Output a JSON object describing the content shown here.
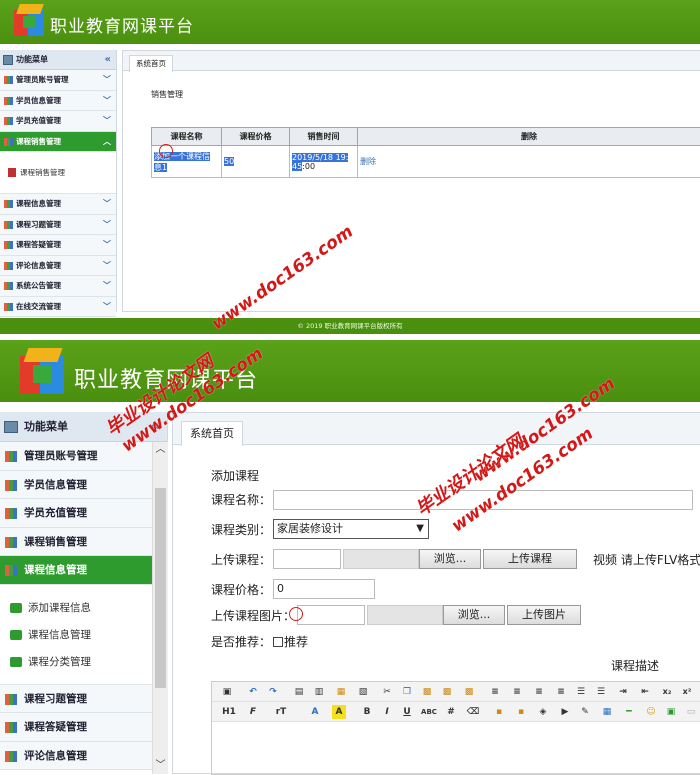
{
  "panel1": {
    "app_title": "职业教育网课平台",
    "menu_header": "功能菜单",
    "menu_items": [
      {
        "label": "管理员账号管理",
        "active": false
      },
      {
        "label": "学员信息管理",
        "active": false
      },
      {
        "label": "学员充值管理",
        "active": false
      },
      {
        "label": "课程销售管理",
        "active": true
      },
      {
        "label": "课程信息管理",
        "active": false
      },
      {
        "label": "课程习题管理",
        "active": false
      },
      {
        "label": "课程答疑管理",
        "active": false
      },
      {
        "label": "评论信息管理",
        "active": false
      },
      {
        "label": "系统公告管理",
        "active": false
      },
      {
        "label": "在线交流管理",
        "active": false
      }
    ],
    "submenu_item": "课程销售管理",
    "tab": "系统首页",
    "section_title": "销售管理",
    "table": {
      "headers": [
        "课程名称",
        "课程价格",
        "销售时间",
        "删除"
      ],
      "row": {
        "name_line1": "添加一个课程信",
        "name_line2": "息1",
        "price": "50",
        "time_line1": "2019/5/18 19:",
        "time_line2_sel": "45",
        "time_line2_rest": ":00",
        "action": "删除"
      }
    },
    "footer": "© 2019 职业教育网课平台版权所有"
  },
  "panel2": {
    "app_title": "职业教育网课平台",
    "menu_header": "功能菜单",
    "menu_items_top": [
      {
        "label": "管理员账号管理"
      },
      {
        "label": "学员信息管理"
      },
      {
        "label": "学员充值管理"
      },
      {
        "label": "课程销售管理"
      },
      {
        "label": "课程信息管理"
      }
    ],
    "submenu": [
      "添加课程信息",
      "课程信息管理",
      "课程分类管理"
    ],
    "menu_items_bottom": [
      {
        "label": "课程习题管理"
      },
      {
        "label": "课程答疑管理"
      },
      {
        "label": "评论信息管理"
      }
    ],
    "tab": "系统首页",
    "form": {
      "heading": "添加课程",
      "name_label": "课程名称：",
      "name_value": "",
      "category_label": "课程类别：",
      "category_value": "家居装修设计",
      "upload_label": "上传课程：",
      "browse": "浏览...",
      "upload_course_btn": "上传课程",
      "video_hint": "视频 请上传FLV格式",
      "price_label": "课程价格：",
      "price_value": "0",
      "image_label": "上传课程图片：",
      "upload_image_btn": "上传图片",
      "recommend_label": "是否推荐：",
      "recommend_option": "推荐",
      "desc_label": "课程描述"
    },
    "toolbar_row2": [
      "H1",
      "F",
      "rT",
      "A",
      "A",
      "B",
      "I",
      "U",
      "ABC"
    ]
  },
  "watermarks": [
    "www.doc163.com",
    "毕业设计论文网"
  ]
}
